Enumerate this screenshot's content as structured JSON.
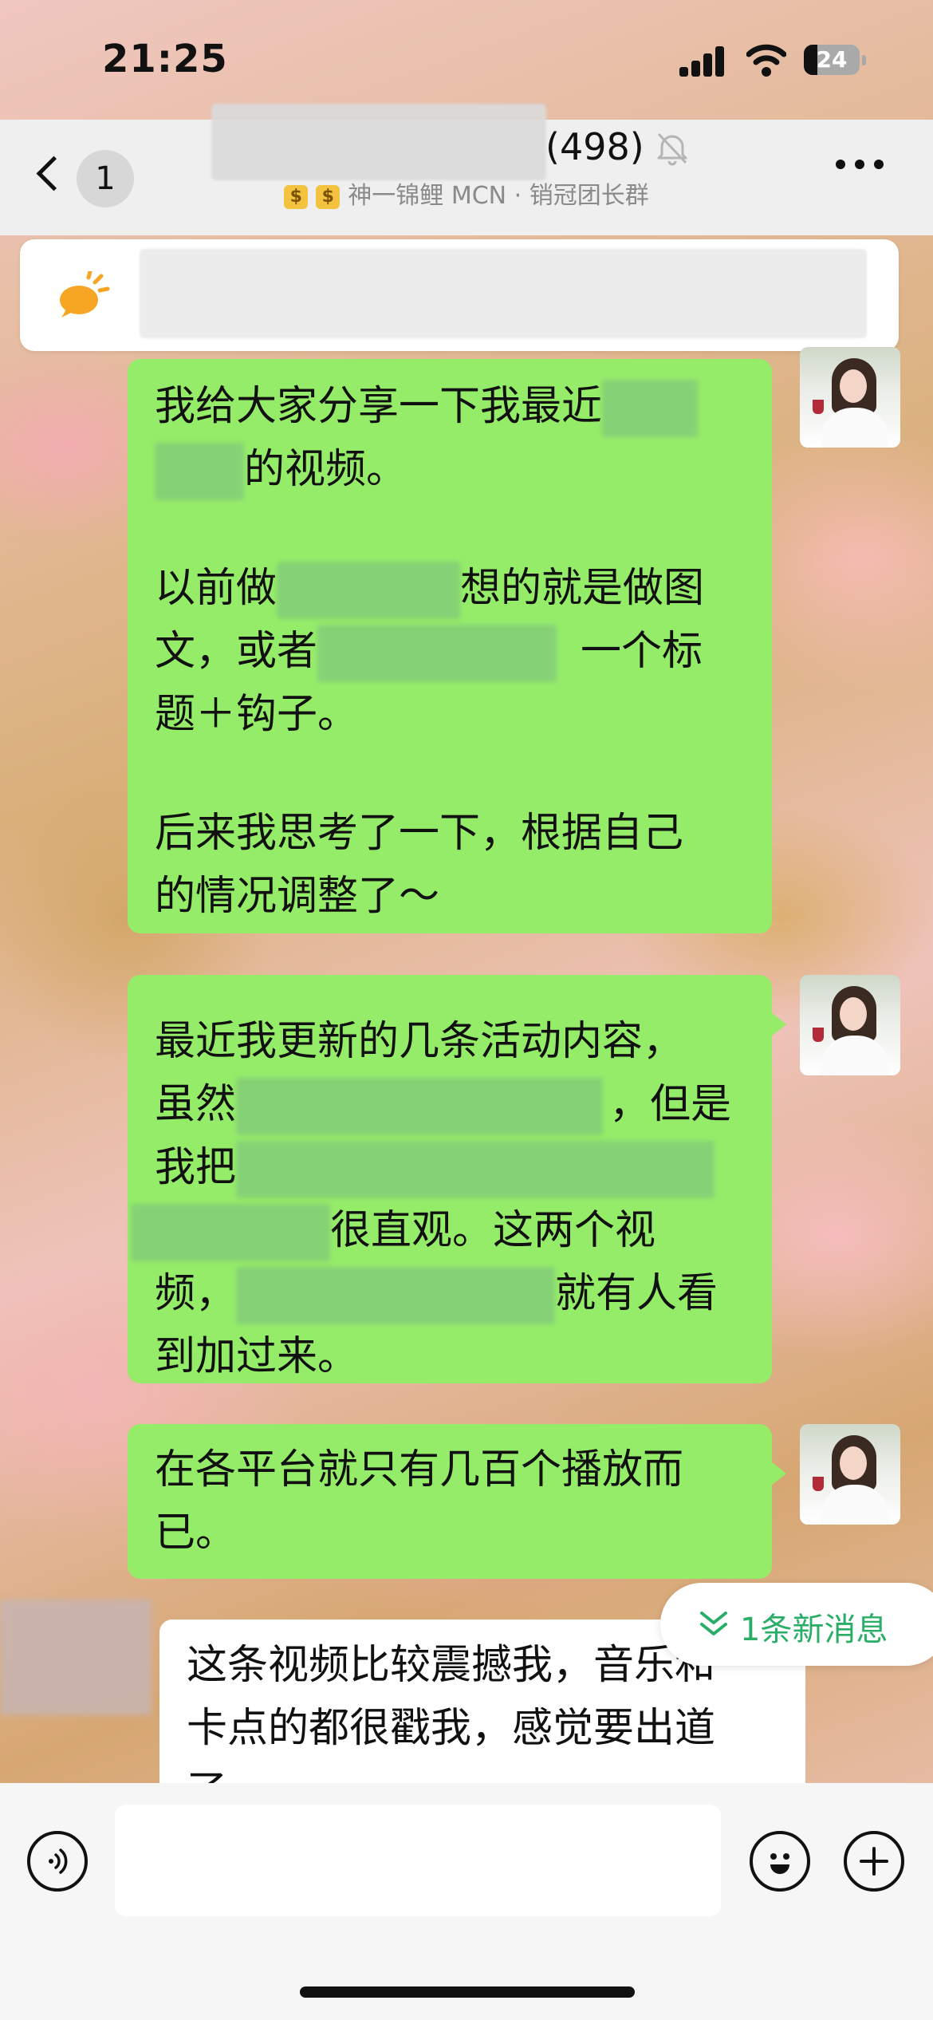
{
  "status_bar": {
    "time": "21:25",
    "battery": "24"
  },
  "header": {
    "back_label": "back",
    "unread_count": "1",
    "group_member_count": "(498)",
    "group_subtitle": "神一锦鲤 MCN · 销冠团长群",
    "coin_glyph": "$"
  },
  "messages": [
    {
      "sender": "self",
      "lines": [
        {
          "parts": [
            "我给大家分享一下我最近"
          ]
        },
        {
          "parts": [
            "的视频。"
          ]
        },
        {
          "gap": true
        },
        {
          "parts": [
            "以前做",
            "想的就是做图"
          ]
        },
        {
          "parts": [
            "文，或者",
            "一个标"
          ]
        },
        {
          "parts": [
            "题＋钩子。"
          ]
        },
        {
          "gap": true
        },
        {
          "parts": [
            "后来我思考了一下，根据自己"
          ]
        },
        {
          "parts": [
            "的情况调整了～"
          ]
        }
      ]
    },
    {
      "sender": "self",
      "lines": [
        {
          "parts": [
            "最近我更新的几条活动内容，"
          ]
        },
        {
          "parts": [
            "虽然",
            "，但是"
          ]
        },
        {
          "parts": [
            "我把"
          ]
        },
        {
          "parts": [
            "很直观。这两个视"
          ]
        },
        {
          "parts": [
            "频，",
            "就有人看"
          ]
        },
        {
          "parts": [
            "到加过来。"
          ]
        }
      ]
    },
    {
      "sender": "self",
      "lines": [
        {
          "parts": [
            "在各平台就只有几百个播放而"
          ]
        },
        {
          "parts": [
            "已。"
          ]
        }
      ]
    },
    {
      "sender": "other",
      "lines": [
        {
          "parts": [
            "这条视频比较震撼我，音乐和"
          ]
        },
        {
          "parts": [
            "卡点的都很戳我，感觉要出道"
          ]
        },
        {
          "parts": [
            "了"
          ]
        }
      ]
    }
  ],
  "new_messages_pill": "1条新消息",
  "input": {
    "value": "",
    "placeholder": ""
  },
  "colors": {
    "self_bubble": "#95ec69",
    "other_bubble": "#ffffff",
    "accent_green": "#2aae67"
  }
}
